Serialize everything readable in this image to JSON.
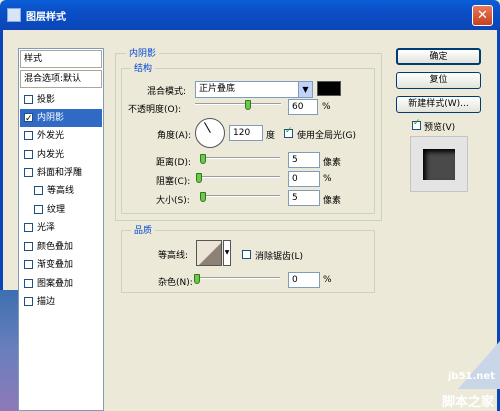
{
  "window": {
    "title": "图层样式",
    "close_glyph": "✕"
  },
  "left_panel": {
    "header": "样式",
    "blend_options": "混合选项:默认",
    "items": [
      {
        "label": "投影",
        "checked": false
      },
      {
        "label": "内阴影",
        "checked": true,
        "selected": true
      },
      {
        "label": "外发光",
        "checked": false
      },
      {
        "label": "内发光",
        "checked": false
      },
      {
        "label": "斜面和浮雕",
        "checked": false
      },
      {
        "label": "等高线",
        "checked": false
      },
      {
        "label": "纹理",
        "checked": false
      },
      {
        "label": "光泽",
        "checked": false
      },
      {
        "label": "颜色叠加",
        "checked": false
      },
      {
        "label": "渐变叠加",
        "checked": false
      },
      {
        "label": "图案叠加",
        "checked": false
      },
      {
        "label": "描边",
        "checked": false
      }
    ]
  },
  "inner_shadow": {
    "section_title": "内阴影",
    "structure_title": "结构",
    "blend_mode_label": "混合模式:",
    "blend_mode_value": "正片叠底",
    "opacity_label": "不透明度(O):",
    "opacity_value": "60",
    "percent": "%",
    "angle_label": "角度(A):",
    "angle_value": "120",
    "degree_unit": "度",
    "global_light_label": "使用全局光(G)",
    "distance_label": "距离(D):",
    "distance_value": "5",
    "choke_label": "阻塞(C):",
    "choke_value": "0",
    "size_label": "大小(S):",
    "size_value": "5",
    "pixel_unit": "像素",
    "quality_title": "品质",
    "contour_label": "等高线:",
    "anti_alias_label": "消除锯齿(L)",
    "noise_label": "杂色(N):",
    "noise_value": "0"
  },
  "buttons": {
    "ok": "确定",
    "reset": "复位",
    "new_style": "新建样式(W)...",
    "preview_label": "预览(V)"
  },
  "watermark": {
    "line1": "jb51.net",
    "line2": "脚本之家"
  },
  "colors": {
    "title_bar": "#0a4ec6",
    "selected": "#316ac5",
    "section_title": "#0046d5",
    "swatch": "#000000"
  }
}
